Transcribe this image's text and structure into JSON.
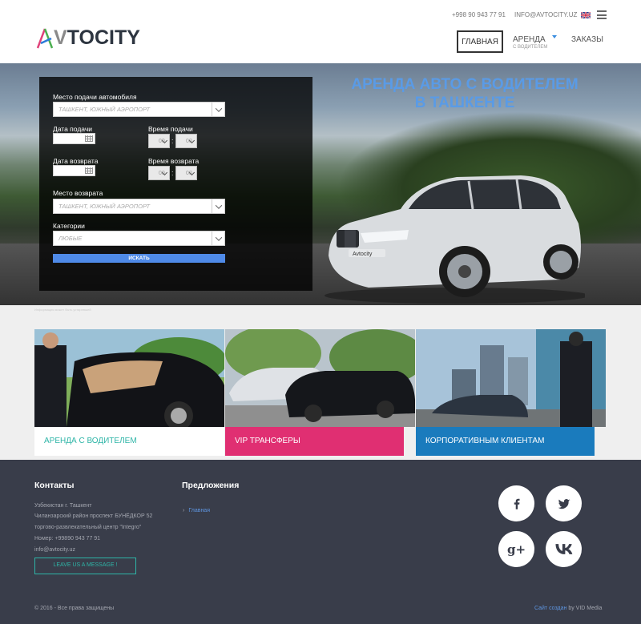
{
  "header": {
    "logo_part1": "AV",
    "logo_part2": "TOCITY",
    "phone": "+998 90 943 77 91",
    "email": "INFO@AVTOCITY.UZ",
    "nav": {
      "home": "ГЛАВНАЯ",
      "rent": "АРЕНДА",
      "rent_sub": "С ВОДИТЕЛЕМ",
      "orders": "ЗАКАЗЫ"
    },
    "icons": [
      "uk-flag-icon",
      "menu-icon"
    ]
  },
  "hero": {
    "title_line1": "АРЕНДА АВТО С ВОДИТЕЛЕМ",
    "title_line2": "В ТАШКЕНТЕ",
    "car_plate": "Avtocity",
    "note": "Информация может быть устаревшей"
  },
  "booking": {
    "pickup_label": "Место подачи автомобиля",
    "pickup_value": "ТАШКЕНТ, ЮЖНЫЙ АЭРОПОРТ",
    "pickup_date_label": "Дата подачи",
    "pickup_time_label": "Время подачи",
    "return_date_label": "Дата возврата",
    "return_time_label": "Время возврата",
    "time_hour": "00",
    "time_min": "00",
    "return_place_label": "Место возврата",
    "return_place_value": "ТАШКЕНТ, ЮЖНЫЙ АЭРОПОРТ",
    "category_label": "Категории",
    "category_value": "ЛЮБЫЕ",
    "search_label": "ИСКАТЬ"
  },
  "services": [
    {
      "label": "АРЕНДА С ВОДИТЕЛЕМ",
      "color": "#ffffff",
      "text_color": "#2eb5a7"
    },
    {
      "label": "VIP ТРАНСФЕРЫ",
      "color": "#e02f72",
      "text_color": "#ffffff"
    },
    {
      "label": "КОРПОРАТИВНЫМ КЛИЕНТАМ",
      "color": "#1a7bbd",
      "text_color": "#ffffff"
    }
  ],
  "footer": {
    "contacts_title": "Контакты",
    "address1": "Узбекистан г. Ташкент",
    "address2": "Чиланзарский район проспект БУНЁДКОР 52",
    "address3": "торгово-развлекательный центр \"Integro\"",
    "phone": "Номер: +99890 943 77 91",
    "email": "info@avtocity.uz",
    "message_button": "LEAVE US A MESSAGE !",
    "offers_title": "Предложения",
    "offer_link": "Главная",
    "social": {
      "facebook": "f",
      "twitter": "t",
      "googleplus": "g+",
      "vk": "vk"
    },
    "copyright": "© 2016 - Все права защищены",
    "made_link": "Сайт создан",
    "made_by": " by VID Media"
  },
  "colors": {
    "accent_blue": "#5a9be6",
    "teal": "#2eb5a7",
    "pink": "#e02f72",
    "blue": "#1a7bbd",
    "footer_bg": "#393d4a"
  }
}
